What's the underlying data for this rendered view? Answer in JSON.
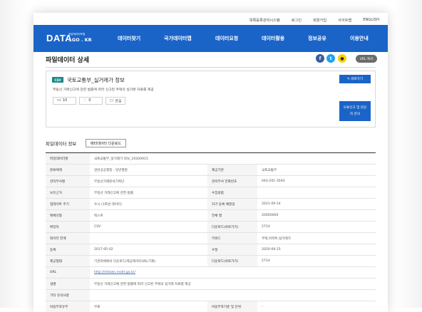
{
  "topbar": {
    "links": [
      "목록등록관리시스템",
      "로그인",
      "회원가입",
      "사이트맵",
      "ENGLISH"
    ]
  },
  "header": {
    "logo_main": "DATA",
    "logo_sub": "공공데이터포털",
    "logo_kr": ". GO . KR",
    "nav": [
      "데이터찾기",
      "국가데이터맵",
      "데이터요청",
      "데이터활용",
      "정보공유",
      "이용안내"
    ],
    "brand_color": "#1a64c8"
  },
  "page": {
    "title": "파일데이터 상세",
    "url_copy": "URL 복사"
  },
  "card": {
    "badge": "CSV",
    "title": "국토교통부_실거래가 정보",
    "description": "부동산 거래신고에 관한 법률에 따라 신고된 주택의 실거래 자료를 제공",
    "likes": "10",
    "comments": "0",
    "interest": "관심",
    "shortcut": "바로가기",
    "inquiry": "오류신고 및 담당자 문의"
  },
  "info": {
    "section_title": "파일데이터 정보",
    "meta_download": "메타데이터 다운로드",
    "rows": [
      {
        "l1": "파일데이터명",
        "v1": "국토교통부_실거래가 정보_20200915",
        "l2": "",
        "v2": "",
        "full": true
      },
      {
        "l1": "분류체계",
        "v1": "일반공공행정 - 일반행정",
        "l2": "제공기관",
        "v2": "국토교통부"
      },
      {
        "l1": "관리부서명",
        "v1": "부동산거래분석기획단",
        "l2": "관리부서 전화번호",
        "v2": "044-201-3593"
      },
      {
        "l1": "보유근거",
        "v1": "부동산 거래신고에 관한 법률",
        "l2": "수집방법",
        "v2": ""
      },
      {
        "l1": "업데이트 주기",
        "v1": "수시 (1회성 데이터)",
        "l2": "차기 등록 예정일",
        "v2": "2021-09-14"
      },
      {
        "l1": "매체유형",
        "v1": "텍스트",
        "l2": "전체 행",
        "v2": "20000000"
      },
      {
        "l1": "확장자",
        "v1": "CSV",
        "l2": "다운로드(바로가기)",
        "v2": "2714"
      },
      {
        "l1": "데이터 한계",
        "v1": "",
        "l2": "키워드",
        "v2": "주택,아파트,실거래가"
      },
      {
        "l1": "등록",
        "v1": "2017-05-02",
        "l2": "수정",
        "v2": "2020-09-15"
      },
      {
        "l1": "제공형태",
        "v1": "기관자체에서 다운로드(제공데이터URL기재)",
        "l2": "다운로드(바로가기)",
        "v2": "2714"
      },
      {
        "l1": "URL",
        "v1": "http://rtdown.molit.go.kr/",
        "l2": "",
        "v2": "",
        "full": true,
        "link": true
      },
      {
        "l1": "설명",
        "v1": "부동산 거래신고에 관한 법률에 따라 신고된 주택의 실거래 자료를 제공",
        "l2": "",
        "v2": "",
        "full": true
      },
      {
        "l1": "기타 유의사항",
        "v1": "",
        "l2": "",
        "v2": "",
        "full": true
      },
      {
        "l1": "비용부과유무",
        "v1": "무료",
        "l2": "비용부과기준 및 단위",
        "v2": "-"
      }
    ]
  }
}
